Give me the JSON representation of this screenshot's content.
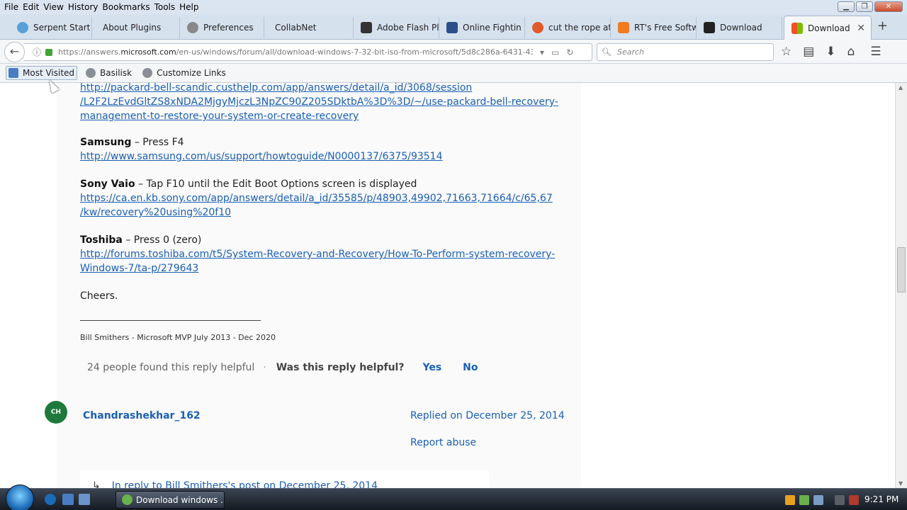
{
  "menubar": {
    "items": [
      "File",
      "Edit",
      "View",
      "History",
      "Bookmarks",
      "Tools",
      "Help"
    ]
  },
  "tabs": [
    {
      "label": "Serpent Start P",
      "icon_color": "#5aa0d8"
    },
    {
      "label": "About Plugins",
      "icon_color": ""
    },
    {
      "label": "Preferences",
      "icon_color": "#888888"
    },
    {
      "label": "CollabNet",
      "icon_color": ""
    },
    {
      "label": "Adobe Flash Pl",
      "icon_color": "#333333"
    },
    {
      "label": "Online Fightin",
      "icon_color": "#2a4f8a"
    },
    {
      "label": "cut the rope at",
      "icon_color": "#e05a2a"
    },
    {
      "label": "RT's Free Softw",
      "icon_color": "#f07b21"
    },
    {
      "label": "Download",
      "icon_color": "#222222"
    },
    {
      "label": "Download",
      "icon_color": "#f25022",
      "active": true
    }
  ],
  "nav": {
    "url_prefix": "https://answers.",
    "url_domain": "microsoft.com",
    "url_rest": "/en-us/windows/forum/all/download-windows-7-32-bit-iso-from-microsoft/5d8c286a-6431-43",
    "search_placeholder": "Search"
  },
  "bookmarks": [
    {
      "label": "Most Visited",
      "icon": "most-visited-icon"
    },
    {
      "label": "Basilisk",
      "icon": "basilisk-icon"
    },
    {
      "label": "Customize Links",
      "icon": "customize-links-icon"
    }
  ],
  "post": {
    "packard_link_1": "http://packard-bell-scandic.custhelp.com/app/answers/detail/a_id/3068/session",
    "packard_link_2": "/L2F2LzEvdGltZS8xNDA2MjgyMjczL3NpZC90Z205SDktbA%3D%3D/~/use-packard-bell-recovery-",
    "packard_link_3": "management-to-restore-your-system-or-create-recovery",
    "samsung_brand": "Samsung",
    "samsung_text": " – Press F4",
    "samsung_link": "http://www.samsung.com/us/support/howtoguide/N0000137/6375/93514",
    "sony_brand": "Sony Vaio",
    "sony_text": " – Tap F10 until the Edit Boot Options screen is displayed",
    "sony_link_1": "https://ca.en.kb.sony.com/app/answers/detail/a_id/35585/p/48903,49902,71663,71664/c/65,67",
    "sony_link_2": "/kw/recovery%20using%20f10",
    "toshiba_brand": "Toshiba",
    "toshiba_text": " – Press 0 (zero)",
    "toshiba_link_1": "http://forums.toshiba.com/t5/System-Recovery-and-Recovery/How-To-Perform-system-recovery-",
    "toshiba_link_2": "Windows-7/ta-p/279643",
    "closing": "Cheers.",
    "signature": "Bill Smithers - Microsoft MVP  July 2013 - Dec 2020",
    "helpful_count": "24 people found this reply helpful",
    "helpful_sep": "·",
    "helpful_question": "Was this reply helpful?",
    "yes": "Yes",
    "no": "No"
  },
  "reply": {
    "avatar_initials": "CH",
    "username": "Chandrashekhar_162",
    "replied_on": "Replied on December 25, 2014",
    "report": "Report abuse",
    "in_reply": "In reply to Bill Smithers's post on December 25, 2014"
  },
  "taskbar": {
    "active_window": "Download windows ...",
    "clock": "9:21 PM"
  }
}
